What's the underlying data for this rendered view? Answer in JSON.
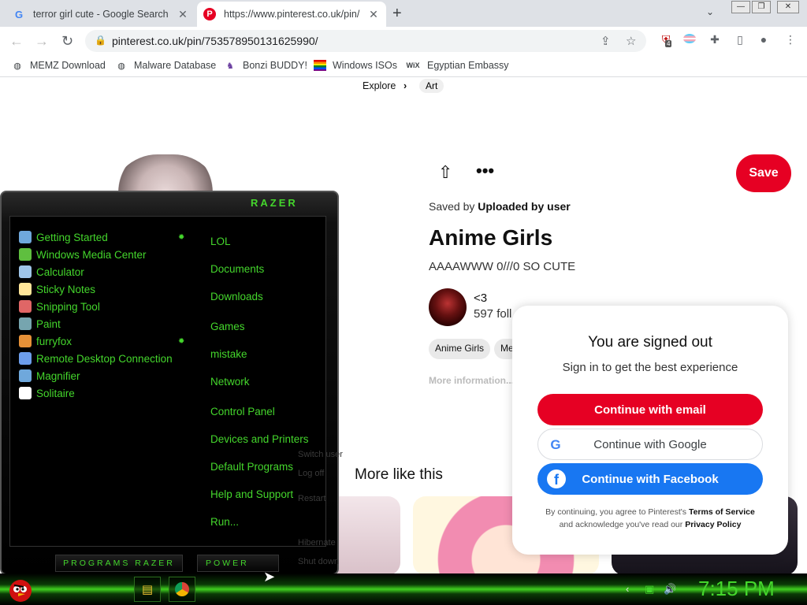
{
  "browser": {
    "tabs": [
      {
        "title": "terror girl cute - Google Search",
        "favicon": "google-g-icon"
      },
      {
        "title": "https://www.pinterest.co.uk/pin/",
        "favicon": "pinterest-icon"
      }
    ],
    "url": "pinterest.co.uk/pin/753578950131625990/",
    "extension_badge": "4",
    "bookmarks": [
      {
        "label": "MEMZ Download",
        "icon": "globe-icon"
      },
      {
        "label": "Malware Database",
        "icon": "globe-icon"
      },
      {
        "label": "Bonzi BUDDY!",
        "icon": "bonzi-icon"
      },
      {
        "label": "Windows ISOs",
        "icon": "windows-flag-icon"
      },
      {
        "label": "Egyptian Embassy",
        "icon": "wix-icon"
      }
    ],
    "wix_label": "WiX"
  },
  "pin": {
    "breadcrumb_explore": "Explore",
    "breadcrumb_sep": "›",
    "breadcrumb_art": "Art",
    "save_label": "Save",
    "saved_by_prefix": "Saved by",
    "saved_by_user": "Uploaded by user",
    "title": "Anime Girls",
    "description": "AAAAWWW 0///0 SO CUTE",
    "creator_name": "<3",
    "followers": "597 foll",
    "tags": [
      "Anime Girls",
      "Me"
    ],
    "more_info": "More information...",
    "more_like_this": "More like this"
  },
  "signin": {
    "title": "You are signed out",
    "subtitle": "Sign in to get the best experience",
    "email_btn": "Continue with email",
    "google_btn": "Continue with Google",
    "facebook_btn": "Continue with Facebook",
    "terms_1": "By continuing, you agree to Pinterest's",
    "terms_link": "Terms of Service",
    "terms_2": "and acknowledge you've read our",
    "privacy_link": "Privacy Policy"
  },
  "startmenu": {
    "logo": "RAZER",
    "programs": [
      {
        "label": "Getting Started",
        "icon": "getting-started-icon",
        "color": "#6fa8dc"
      },
      {
        "label": "Windows Media Center",
        "icon": "media-center-icon",
        "color": "#5fbf3f"
      },
      {
        "label": "Calculator",
        "icon": "calculator-icon",
        "color": "#9fc5e8"
      },
      {
        "label": "Sticky Notes",
        "icon": "sticky-notes-icon",
        "color": "#ffe599"
      },
      {
        "label": "Snipping Tool",
        "icon": "scissors-icon",
        "color": "#e06666"
      },
      {
        "label": "Paint",
        "icon": "paint-icon",
        "color": "#76a5af"
      },
      {
        "label": "furryfox",
        "icon": "firefox-icon",
        "color": "#e69138"
      },
      {
        "label": "Remote Desktop Connection",
        "icon": "remote-desktop-icon",
        "color": "#6d9eeb"
      },
      {
        "label": "Magnifier",
        "icon": "magnifier-icon",
        "color": "#6fa8dc"
      },
      {
        "label": "Solitaire",
        "icon": "solitaire-icon",
        "color": "#ffffff"
      }
    ],
    "places": [
      "LOL",
      "Documents",
      "Downloads",
      "Games",
      "mistake",
      "Network",
      "Control Panel",
      "Devices and Printers",
      "Default Programs",
      "Help and Support",
      "Run..."
    ],
    "power_options": [
      "Switch user",
      "Log off",
      "Restart",
      "Hibernate",
      "Shut down"
    ],
    "programs_bar": "PROGRAMS RAZER",
    "power_bar": "POWER"
  },
  "taskbar": {
    "clock": "7:15 PM"
  }
}
